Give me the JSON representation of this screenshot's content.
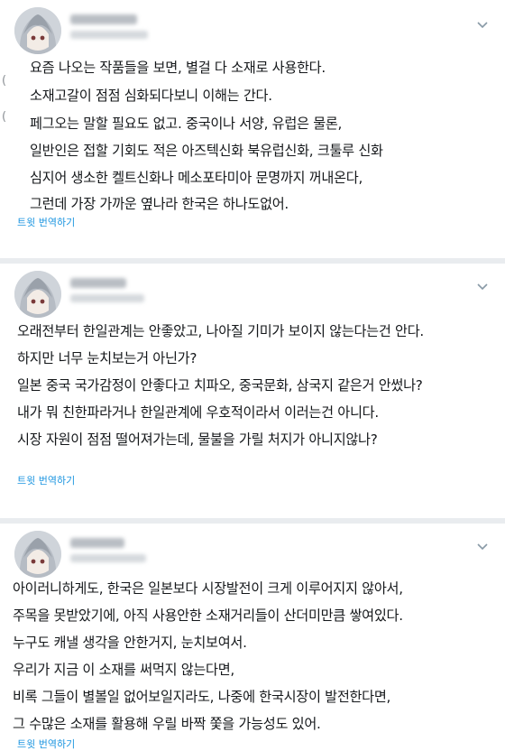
{
  "tweets": [
    {
      "lines": [
        "요즘 나오는 작품들을 보면, 별걸 다 소재로 사용한다.",
        "소재고갈이 점점 심화되다보니 이해는 간다.",
        "페그오는 말할 필요도 없고. 중국이나 서양, 유럽은 물론,",
        "일반인은 접할 기회도 적은 아즈텍신화 북유럽신화, 크툴루 신화",
        "심지어 생소한 켈트신화나 메소포타미아 문명까지 꺼내온다,",
        "그런데 가장 가까운 옆나라 한국은 하나도없어."
      ],
      "translate_label": "트윗 번역하기"
    },
    {
      "lines": [
        "오래전부터 한일관계는 안좋았고, 나아질 기미가 보이지 않는다는건 안다.",
        "하지만 너무 눈치보는거 아닌가?",
        "일본 중국 국가감정이 안좋다고 치파오, 중국문화, 삼국지 같은거 안썼나?",
        "내가 뭐 친한파라거나 한일관계에 우호적이라서 이러는건 아니다.",
        "시장 자원이 점점 떨어져가는데, 물불을 가릴 처지가 아니지않나?"
      ],
      "translate_label": "트윗 번역하기"
    },
    {
      "lines": [
        "아이러니하게도, 한국은 일본보다 시장발전이 크게 이루어지지 않아서,",
        "주목을 못받았기에, 아직 사용안한 소재거리들이 산더미만큼 쌓여있다.",
        "누구도 캐낼 생각을 안한거지, 눈치보여서.",
        "우리가 지금 이 소재를 써먹지 않는다면,",
        "비록 그들이 별볼일 없어보일지라도, 나중에 한국시장이 발전한다면,",
        "그 수많은 소재를 활용해 우릴 바짝 쫓을 가능성도 있어."
      ],
      "translate_label": "트윗 번역하기"
    }
  ],
  "icons": {
    "avatar": "anime-avatar-icon",
    "chevron": "chevron-down-icon"
  },
  "colors": {
    "text": "#14171a",
    "link": "#1b95e0",
    "separator": "#e9ecef"
  }
}
